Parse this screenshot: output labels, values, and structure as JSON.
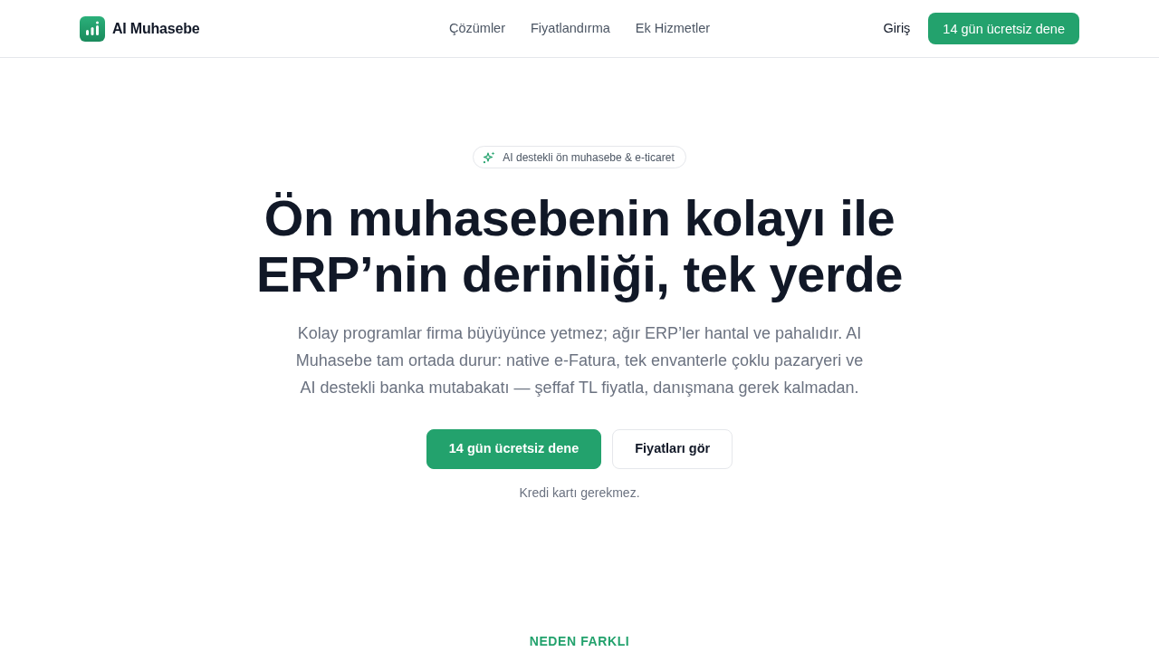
{
  "navbar": {
    "brand": "AI Muhasebe",
    "links": [
      "Çözümler",
      "Fiyatlandırma",
      "Ek Hizmetler"
    ],
    "login": "Giriş",
    "cta": "14 gün ücretsiz dene"
  },
  "hero": {
    "badge": "AI destekli ön muhasebe & e-ticaret",
    "title": "Ön muhasebenin kolayı ile ERP’nin derinliği, tek yerde",
    "description": "Kolay programlar firma büyüyünce yetmez; ağır ERP’ler hantal ve pahalıdır. AI Muhasebe tam ortada durur: native e-Fatura, tek envanterle çoklu pazaryeri ve AI destekli banka mutabakatı — şeffaf TL fiyatla, danışmana gerek kalmadan.",
    "buttons": [
      {
        "label": "14 gün ücretsiz dene",
        "kind": "primary"
      },
      {
        "label": "Fiyatları gör",
        "kind": "secondary"
      }
    ],
    "note": "Kredi kartı gerekmez."
  },
  "next_section": {
    "eyebrow": "NEDEN FARKLI"
  }
}
